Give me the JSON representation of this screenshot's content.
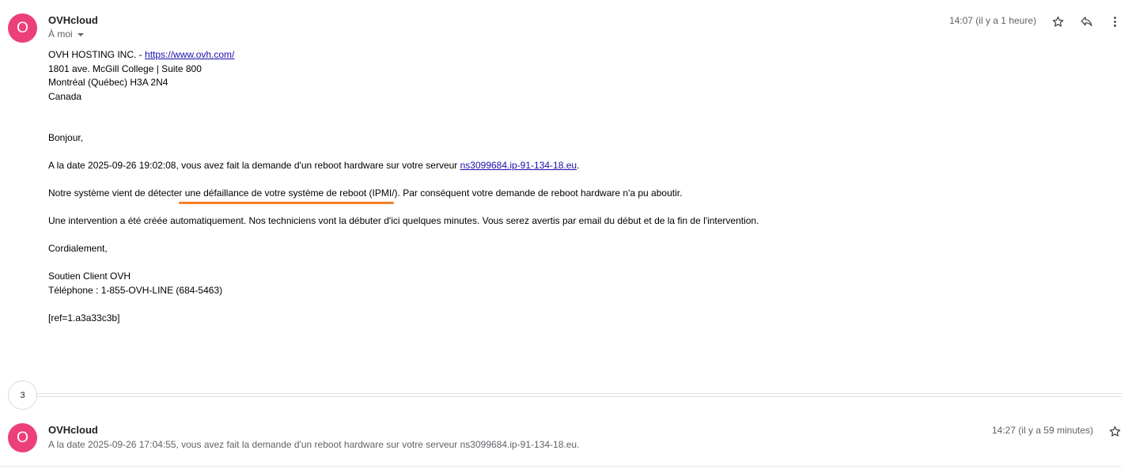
{
  "message1": {
    "avatar_letter": "O",
    "sender": "OVHcloud",
    "recipient": "À moi",
    "time": "14:07 (il y a 1 heure)",
    "body": {
      "company_prefix": "OVH HOSTING INC. - ",
      "company_link": "https://www.ovh.com/",
      "address1": "1801 ave. McGill College | Suite 800",
      "address2": "Montréal (Québec) H3A 2N4",
      "country": "Canada",
      "greeting": "Bonjour,",
      "p1_prefix": "A la date 2025-09-26 19:02:08, vous avez fait la demande d'un reboot hardware sur votre serveur ",
      "p1_link": "ns3099684.ip-91-134-18.eu",
      "p1_suffix": ".",
      "p2": "Notre système vient de détecter une défaillance de votre système de reboot (IPMI/). Par conséquent votre demande de reboot hardware n'a pu aboutir.",
      "p3": "Une intervention a été créée automatiquement. Nos techniciens vont la débuter d'ici quelques minutes. Vous serez avertis par email du début et de la fin de l'intervention.",
      "closing": "Cordialement,",
      "signature1": "Soutien Client OVH",
      "signature2": "Téléphone : 1-855-OVH-LINE (684-5463)",
      "ref": "[ref=1.a3a33c3b]"
    }
  },
  "collapsed_count": "3",
  "message2": {
    "avatar_letter": "O",
    "sender": "OVHcloud",
    "time": "14:27 (il y a 59 minutes)",
    "snippet": "A la date 2025-09-26 17:04:55, vous avez fait la demande d'un reboot hardware sur votre serveur ns3099684.ip-91-134-18.eu."
  },
  "colors": {
    "avatar": "#ec407a",
    "link": "#1a0dab",
    "highlight": "#f57f25"
  },
  "icons": [
    "star-icon",
    "reply-icon",
    "more-vert-icon"
  ]
}
